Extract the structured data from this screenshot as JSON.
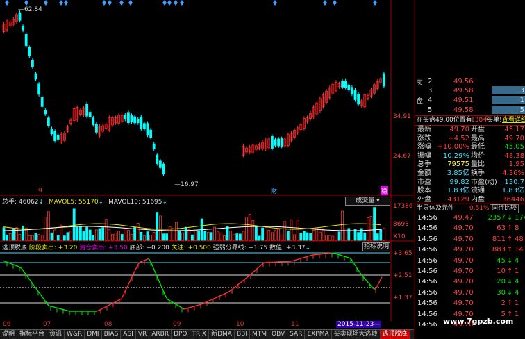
{
  "price_panel": {
    "high_label": "62.84",
    "low_label": "16.97",
    "y_labels": [
      "34.91",
      "24.67"
    ],
    "marker_q": "q",
    "marker_cai": "财",
    "marker_wen": "稳"
  },
  "volume_panel": {
    "total_label": "总手: 46062",
    "mavol5": "MAVOL5: 55170",
    "mavol10": "MAVOL10: 51695",
    "dropdown": "成交量",
    "y_labels": [
      "17386",
      "8693",
      "X10"
    ]
  },
  "indicator_panel": {
    "title": "逃顶脱底",
    "sell_stage": "阶段卖出: +3.20",
    "clear_sell": "清仓卖出: +3.50",
    "bottom": "底部: +0.200",
    "attention": "关注: +0.500",
    "strength": "强弱分界线: +1.75",
    "value": "数值: +3.37",
    "help_button": "指标说明",
    "y_labels": [
      "+3.65",
      "+2.51",
      "+1.37"
    ]
  },
  "x_axis": {
    "labels": [
      "06",
      "07",
      "08",
      "09",
      "10",
      "11"
    ],
    "cursor_date": "2015-11-23"
  },
  "tabs": [
    "说明",
    "指标平台",
    "资讯",
    "W&R",
    "DMI",
    "BIAS",
    "ASI",
    "VR",
    "ARBR",
    "DPO",
    "TRIX",
    "新DMA",
    "BBI",
    "MTM",
    "OBV",
    "SAR",
    "EXPMA",
    "买卖现场大逃炒",
    "逃顶脱底"
  ],
  "quote_panel": {
    "order_rows": [
      {
        "label": "2",
        "price": "49.56",
        "vol": "",
        "partial": true
      },
      {
        "label": "3",
        "price": "49.58",
        "vol": "3"
      },
      {
        "label": "4",
        "price": "49.51",
        "vol": "1"
      },
      {
        "label": "5",
        "price": "49.58",
        "vol": "5"
      }
    ],
    "order_side_top": "买",
    "order_side_mid": "盘",
    "position_text": "在买盘49.00位置有",
    "position_count": "138手",
    "position_action": "买单!",
    "position_link": "查看详细",
    "stats": [
      {
        "l1": "最新",
        "v1": "49.70",
        "l2": "开盘",
        "v2": "45.17"
      },
      {
        "l1": "涨跌",
        "v1": "+4.52",
        "l2": "最高",
        "v2": "49.70"
      },
      {
        "l1": "涨幅",
        "v1": "+10.00%",
        "l2": "最低",
        "v2": "45.05"
      },
      {
        "l1": "振幅",
        "v1": "10.29%",
        "l2": "均价",
        "v2": "48.38"
      },
      {
        "l1": "总手",
        "v1": "79575",
        "l2": "量比",
        "v2": "1.95"
      },
      {
        "l1": "金额",
        "v1": "3.85亿",
        "l2": "换手",
        "v2": "4.36%"
      },
      {
        "l1": "市盈",
        "v1": "99.82",
        "l2": "市盈(动)",
        "v2": "130.7"
      },
      {
        "l1": "股本",
        "v1": "1.83亿",
        "l2": "流通",
        "v2": "1.83亿"
      },
      {
        "l1": "外盘",
        "v1": "43129",
        "l2": "内盘",
        "v2": "36446"
      }
    ],
    "sector_name": "半导体及元件",
    "sector_change": "0.51%",
    "compare_button": "同行比较",
    "ticks": [
      {
        "time": "14:56",
        "price": "49.47",
        "vol": "2357",
        "dir": "down",
        "extra": "174"
      },
      {
        "time": "14:56",
        "price": "49.70",
        "vol": "63",
        "dir": "up",
        "extra": "8"
      },
      {
        "time": "14:56",
        "price": "49.70",
        "vol": "811",
        "dir": "up",
        "extra": "48"
      },
      {
        "time": "14:56",
        "price": "49.70",
        "vol": "883",
        "dir": "up",
        "extra": "14"
      },
      {
        "time": "14:56",
        "price": "49.70",
        "vol": "45",
        "dir": "down",
        "extra": "4"
      },
      {
        "time": "14:56",
        "price": "49.70",
        "vol": "10",
        "dir": "up",
        "extra": "1"
      },
      {
        "time": "14:56",
        "price": "49.70",
        "vol": "20",
        "dir": "down",
        "extra": "4"
      },
      {
        "time": "14:56",
        "price": "49.70",
        "vol": "30",
        "dir": "down",
        "extra": "4"
      },
      {
        "time": "14:56",
        "price": "49.70",
        "vol": "2",
        "dir": "up",
        "extra": "1"
      },
      {
        "time": "14:56",
        "price": "49.70",
        "vol": "5",
        "dir": "up",
        "extra": "1"
      },
      {
        "time": "14:56",
        "price": "49.70",
        "vol": "",
        "dir": "",
        "extra": ""
      }
    ],
    "watermark": "www.7gpzb.com"
  },
  "colors": {
    "up": "#ff3030",
    "down": "#00ffff",
    "bg": "#000000",
    "accent": "#c00000",
    "ma": "#e8e800"
  }
}
